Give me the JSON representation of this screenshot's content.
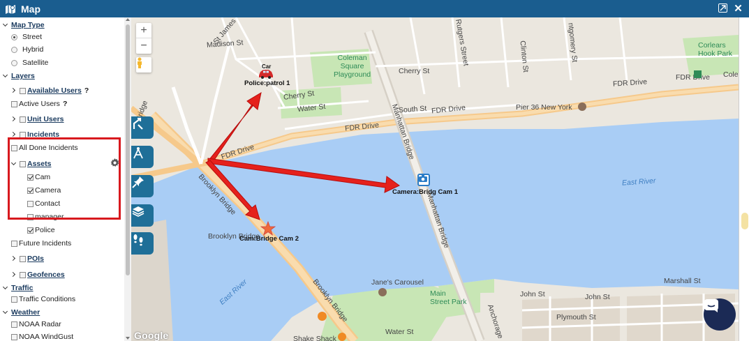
{
  "window": {
    "title": "Map",
    "logo_icon": "map-logo-icon",
    "restore_label": "⤢",
    "close_label": "✕"
  },
  "sidebar": {
    "map_type": {
      "heading": "Map Type",
      "options": [
        {
          "label": "Street",
          "selected": true
        },
        {
          "label": "Hybrid",
          "selected": false
        },
        {
          "label": "Satellite",
          "selected": false
        }
      ]
    },
    "layers": {
      "heading": "Layers",
      "available_users": "Available Users",
      "active_users": "Active Users",
      "unit_users": "Unit Users",
      "incidents": "Incidents",
      "all_done_incidents": "All Done Incidents",
      "assets": {
        "label": "Assets",
        "items": [
          {
            "label": "Cam",
            "checked": true
          },
          {
            "label": "Camera",
            "checked": true
          },
          {
            "label": "Contact",
            "checked": false
          },
          {
            "label": "manager",
            "checked": false
          },
          {
            "label": "Police",
            "checked": true
          }
        ]
      },
      "future_incidents": "Future Incidents",
      "pois": "POIs",
      "geofences": "Geofences"
    },
    "traffic": {
      "heading": "Traffic",
      "conditions": "Traffic Conditions"
    },
    "weather": {
      "heading": "Weather",
      "noaa_radar": "NOAA Radar",
      "noaa_windgust": "NOAA WindGust"
    },
    "help_mark": "?"
  },
  "map": {
    "zoom_in": "+",
    "zoom_out": "−",
    "google_logo": "Google",
    "labels": {
      "madison_st": "Madison St",
      "st_james": "St James",
      "coleman_park": "Coleman\nSquare\nPlayground",
      "cherry_st_top": "Cherry St",
      "cherry_st_left": "Cherry St",
      "water_st": "Water St",
      "south_st": "South St",
      "fdr_drive_1": "FDR Drive",
      "fdr_drive_2": "FDR Drive",
      "fdr_drive_3": "FDR Drive",
      "fdr_drive_4": "FDR Drive",
      "fdr_drive_left": "FDR Drive",
      "pier36": "Pier 36 New York",
      "corlears": "Corlears\nHook Park",
      "east_river_1": "East River",
      "east_river_2": "East River",
      "brooklyn_bridge_1": "Brooklyn Bridge",
      "brooklyn_bridge_2": "Brooklyn Bridge",
      "brooklyn_bridge_3": "Brooklyn Bridge",
      "brooklyn_bridge_top": "Bridge",
      "manhattan_bridge_1": "Manhattan Bridge",
      "manhattan_bridge_2": "Manhattan Bridge",
      "rutgers": "Rutgers Street",
      "clinton": "Clinton St",
      "montgomery": "ntgomery St",
      "janes_carousel": "Jane's Carousel",
      "main_street_park": "Main\nStreet Park",
      "john_st_1": "John St",
      "john_st_2": "John St",
      "plymouth": "Plymouth St",
      "marshall": "Marshall St",
      "water_st_bottom": "Water St",
      "shake_shack": "Shake Shack",
      "anchorage": "Anchorage",
      "cole": "Cole",
      "bridge_top": "Bridge"
    },
    "markers": {
      "car_title": "Car",
      "patrol": "Police:patrol 1",
      "camera": "Camera:Bridg Cam 1",
      "cam": "Cam:Bridge Cam 2"
    }
  }
}
